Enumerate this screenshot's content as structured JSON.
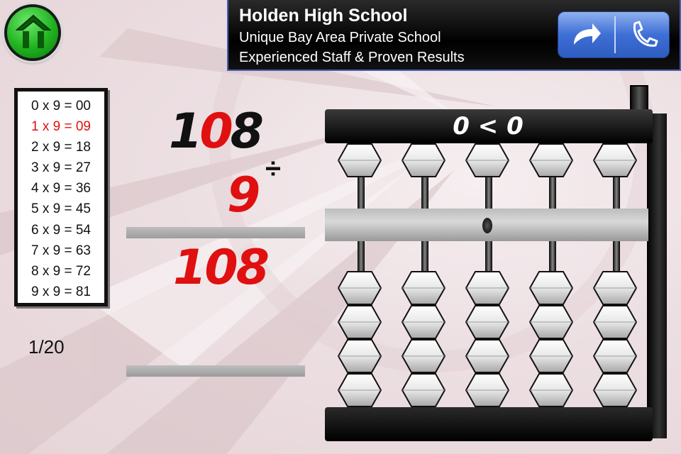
{
  "ad": {
    "title": "Holden High School",
    "line1": "Unique Bay Area Private School",
    "line2": "Experienced Staff & Proven Results"
  },
  "icons": {
    "home": "home-icon",
    "share": "share-arrow-icon",
    "call": "phone-icon"
  },
  "times_table": {
    "rows": [
      "0 x 9 = 00",
      "1 x 9 = 09",
      "2 x 9 = 18",
      "3 x 9 = 27",
      "4 x 9 = 36",
      "5 x 9 = 45",
      "6 x 9 = 54",
      "7 x 9 = 63",
      "8 x 9 = 72",
      "9 x 9 = 81"
    ],
    "active_index": 1,
    "active_color": "#e01010"
  },
  "progress": "1/20",
  "problem": {
    "dividend_digits": [
      "1",
      "0",
      "8"
    ],
    "divisor": "9",
    "operator": "÷",
    "answer": "108"
  },
  "abacus": {
    "display": "0 < 0",
    "columns": 5,
    "upper_beads_per_column": 1,
    "lower_beads_per_column": 4
  },
  "colors": {
    "accent_red": "#e01010",
    "home_green": "#1fb21f",
    "ad_button_blue": "#3e6fd6"
  }
}
